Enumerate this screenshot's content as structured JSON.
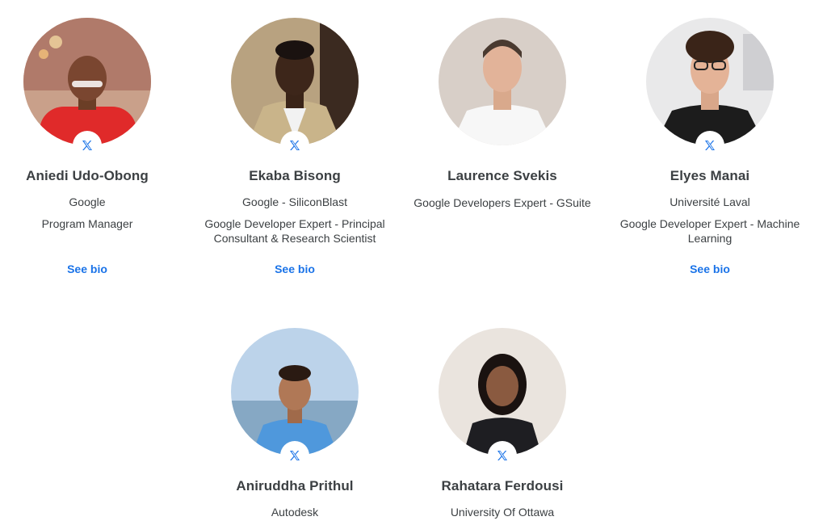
{
  "speakers": [
    {
      "name": "Aniedi Udo-Obong",
      "company": "Google",
      "title": "Program Manager",
      "link": "See bio",
      "social_icon": "x-logo-icon"
    },
    {
      "name": "Ekaba Bisong",
      "company": "Google - SiliconBlast",
      "title": "Google Developer Expert - Principal Consultant & Research Scientist",
      "link": "See bio",
      "social_icon": "x-logo-icon"
    },
    {
      "name": "Laurence Svekis",
      "company": "Google Developers Expert - GSuite",
      "title": "",
      "link": "",
      "social_icon": ""
    },
    {
      "name": "Elyes Manai",
      "company": "Université Laval",
      "title": "Google Developer Expert - Machine Learning",
      "link": "See bio",
      "social_icon": "x-logo-icon"
    },
    {
      "name": "Aniruddha Prithul",
      "company": "Autodesk",
      "title": "",
      "link": "",
      "social_icon": "x-logo-icon"
    },
    {
      "name": "Rahatara Ferdousi",
      "company": "University Of Ottawa",
      "title": "",
      "link": "",
      "social_icon": "x-logo-icon"
    }
  ],
  "colors": {
    "link": "#1a73e8",
    "x_icon": "#1a73e8",
    "text": "#3c4043"
  }
}
